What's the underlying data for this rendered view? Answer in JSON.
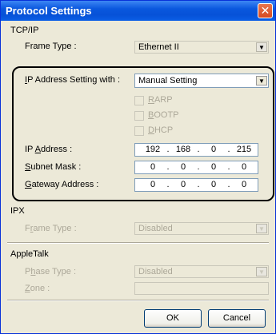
{
  "window": {
    "title": "Protocol Settings",
    "close_glyph": "✕"
  },
  "tcpip": {
    "section_label": "TCP/IP",
    "frame_type": {
      "label": "Frame Type :",
      "value": "Ethernet II"
    },
    "ip_setting": {
      "label_prefix": "",
      "label_u": "I",
      "label_rest": "P Address Setting with :",
      "value": "Manual Setting"
    },
    "rarp": {
      "u": "R",
      "rest": "ARP"
    },
    "bootp": {
      "u": "B",
      "rest": "OOTP"
    },
    "dhcp": {
      "u": "D",
      "rest": "HCP"
    },
    "ip_address": {
      "pre": "IP ",
      "u": "A",
      "rest": "ddress :",
      "octets": [
        "192",
        "168",
        "0",
        "215"
      ]
    },
    "subnet": {
      "pre": "",
      "u": "S",
      "rest": "ubnet Mask :",
      "octets": [
        "0",
        "0",
        "0",
        "0"
      ]
    },
    "gateway": {
      "pre": "",
      "u": "G",
      "rest": "ateway Address :",
      "octets": [
        "0",
        "0",
        "0",
        "0"
      ]
    }
  },
  "ipx": {
    "section_label": "IPX",
    "frame_type": {
      "pre": "F",
      "u": "r",
      "rest": "ame Type :",
      "value": "Disabled"
    }
  },
  "appletalk": {
    "section_label": "AppleTalk",
    "phase_type": {
      "pre": "P",
      "u": "h",
      "rest": "ase Type :",
      "value": "Disabled"
    },
    "zone": {
      "pre": "",
      "u": "Z",
      "rest": "one :",
      "value": ""
    }
  },
  "buttons": {
    "ok": "OK",
    "cancel": "Cancel"
  },
  "icons": {
    "dropdown": "▼"
  }
}
